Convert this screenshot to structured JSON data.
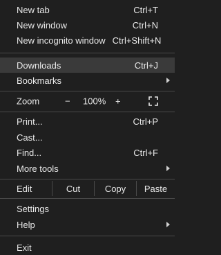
{
  "menu": {
    "items_top": [
      {
        "label": "New tab",
        "shortcut": "Ctrl+T"
      },
      {
        "label": "New window",
        "shortcut": "Ctrl+N"
      },
      {
        "label": "New incognito window",
        "shortcut": "Ctrl+Shift+N"
      }
    ],
    "downloads": {
      "label": "Downloads",
      "shortcut": "Ctrl+J"
    },
    "bookmarks": {
      "label": "Bookmarks"
    },
    "zoom": {
      "label": "Zoom",
      "minus": "−",
      "value": "100%",
      "plus": "+"
    },
    "print": {
      "label": "Print...",
      "shortcut": "Ctrl+P"
    },
    "cast": {
      "label": "Cast..."
    },
    "find": {
      "label": "Find...",
      "shortcut": "Ctrl+F"
    },
    "more_tools": {
      "label": "More tools"
    },
    "edit": {
      "label": "Edit",
      "cut": "Cut",
      "copy": "Copy",
      "paste": "Paste"
    },
    "settings": {
      "label": "Settings"
    },
    "help": {
      "label": "Help"
    },
    "exit": {
      "label": "Exit"
    }
  },
  "colors": {
    "background": "#1f1f1f",
    "highlight": "#3a3a3a",
    "text": "#e8e8e8",
    "separator": "#4a4a4a"
  }
}
